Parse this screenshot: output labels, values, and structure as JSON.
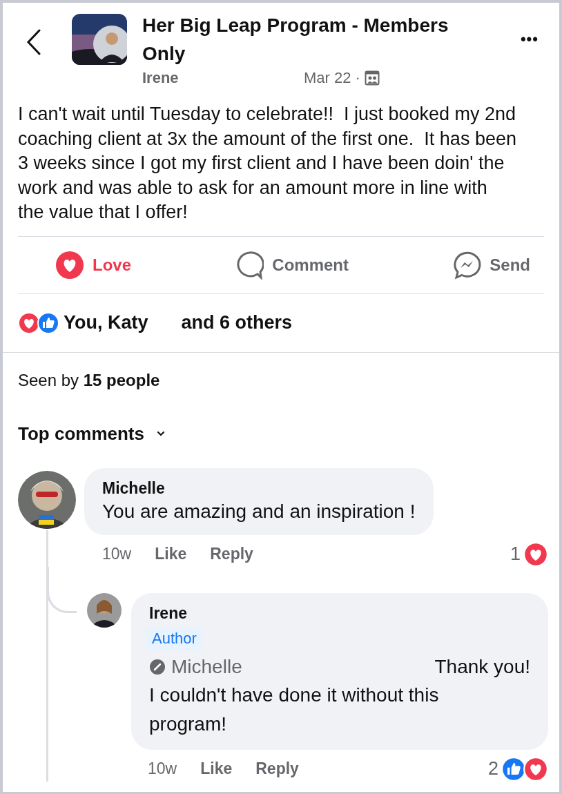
{
  "header": {
    "title": "Her Big Leap Program - Members Only",
    "author": "Irene",
    "date": "Mar 22 ·",
    "more": "•••"
  },
  "post": {
    "text": "I can't wait until Tuesday to celebrate!!  I just booked my 2nd coaching client at 3x the amount of the first one.  It has been 3 weeks since I got my first client and I have been doin' the work and was able to ask for an amount more in line with the value that I offer!"
  },
  "actions": [
    {
      "kind": "love",
      "label": "Love",
      "selected": true
    },
    {
      "kind": "comment",
      "label": "Comment",
      "selected": false
    },
    {
      "kind": "send",
      "label": "Send",
      "selected": false
    }
  ],
  "reactions": {
    "icons": [
      {
        "kind": "love"
      },
      {
        "kind": "like"
      }
    ],
    "names": "You, Katy",
    "rest": "and 6 others"
  },
  "seen": "Seen by **15 people**",
  "comments_header": "Top comments",
  "comments": [
    {
      "author": "Michelle",
      "text": "You are amazing and an inspiration !",
      "time": "10w",
      "like": "Like",
      "reply": "Reply",
      "count": "1",
      "reactions": [
        {
          "kind": "love"
        }
      ],
      "replies": [
        {
          "author": "Irene",
          "badge": "Author",
          "mention": "Michelle",
          "lead": "Thank you!",
          "text": "I couldn't have done it without this program!",
          "time": "10w",
          "like": "Like",
          "reply": "Reply",
          "count": "2",
          "reactions": [
            {
              "kind": "like"
            },
            {
              "kind": "love"
            }
          ]
        }
      ]
    }
  ]
}
